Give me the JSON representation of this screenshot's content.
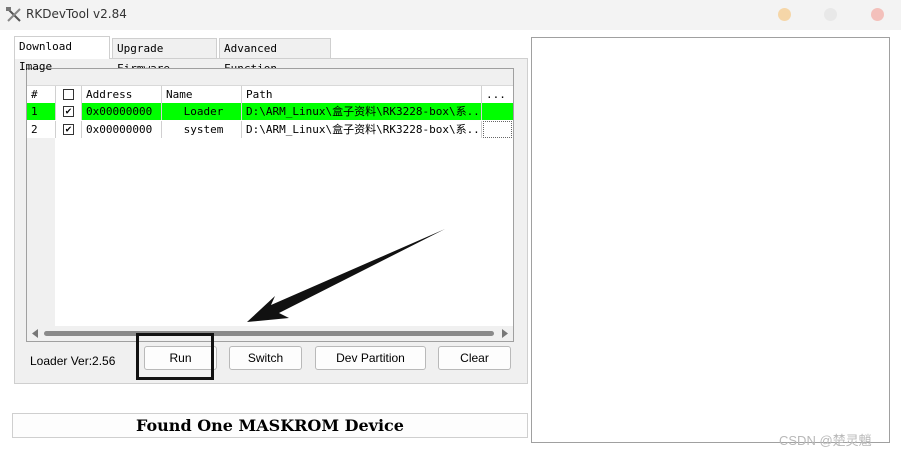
{
  "window": {
    "title": "RKDevTool v2.84"
  },
  "tabs": [
    {
      "label": "Download Image",
      "active": true
    },
    {
      "label": "Upgrade Firmware",
      "active": false
    },
    {
      "label": "Advanced Function",
      "active": false
    }
  ],
  "table": {
    "headers": [
      "#",
      "",
      "Address",
      "Name",
      "Path",
      "..."
    ],
    "rows": [
      {
        "num": "1",
        "checked": true,
        "address": "0x00000000",
        "name": "Loader",
        "path": "D:\\ARM_Linux\\盒子资料\\RK3228-box\\系...",
        "more": "",
        "highlight_color": "#00ff00"
      },
      {
        "num": "2",
        "checked": true,
        "address": "0x00000000",
        "name": "system",
        "path": "D:\\ARM_Linux\\盒子资料\\RK3228-box\\系...",
        "more": ""
      }
    ]
  },
  "loader_version": "Loader Ver:2.56",
  "buttons": {
    "run": "Run",
    "switch": "Switch",
    "dev_partition": "Dev Partition",
    "clear": "Clear"
  },
  "status_text": "Found One MASKROM Device",
  "watermark": "CSDN @楚灵魈",
  "colors": {
    "row_highlight": "#00ff00",
    "annotation": "#111111"
  },
  "icons": {
    "app": "rk-tool-icon"
  }
}
